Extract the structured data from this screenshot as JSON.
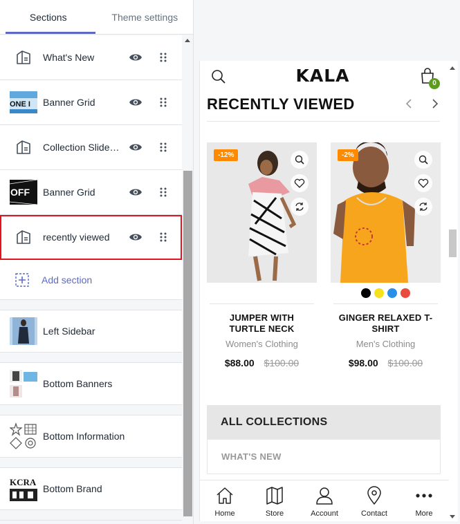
{
  "tabs": [
    {
      "label": "Sections",
      "active": true
    },
    {
      "label": "Theme settings",
      "active": false
    }
  ],
  "sections": [
    {
      "label": "What's New",
      "icon": "section-layout-icon"
    },
    {
      "label": "Banner Grid",
      "icon": "banner-thumbnail-one"
    },
    {
      "label": "Collection Slider…",
      "icon": "section-layout-icon"
    },
    {
      "label": "Banner Grid",
      "icon": "banner-thumbnail-off"
    },
    {
      "label": "recently viewed",
      "icon": "section-layout-icon",
      "selected": true
    }
  ],
  "add_section_label": "Add section",
  "static_sections": [
    {
      "label": "Left Sidebar"
    },
    {
      "label": "Bottom Banners"
    },
    {
      "label": "Bottom Information"
    },
    {
      "label": "Bottom Brand"
    }
  ],
  "thumb_text": {
    "one": "ONE I",
    "off": "OFF",
    "brand": "KCRA"
  },
  "preview": {
    "logo": "KALA",
    "cart_count": "0",
    "recently_viewed_title": "RECENTLY VIEWED",
    "products": [
      {
        "badge": "-12%",
        "name": "JUMPER WITH TURTLE NECK",
        "category": "Women's Clothing",
        "price": "$88.00",
        "old_price": "$100.00"
      },
      {
        "badge": "-2%",
        "name": "GINGER RELAXED T-SHIRT",
        "category": "Men's Clothing",
        "price": "$98.00",
        "old_price": "$100.00",
        "swatches": [
          "#000000",
          "#f5e11c",
          "#2a8fe6",
          "#e84c3d"
        ]
      }
    ],
    "collections_title": "ALL COLLECTIONS",
    "collection_items": [
      "WHAT'S NEW"
    ],
    "bottom_nav": [
      {
        "label": "Home",
        "icon": "home-icon"
      },
      {
        "label": "Store",
        "icon": "map-icon"
      },
      {
        "label": "Account",
        "icon": "user-icon"
      },
      {
        "label": "Contact",
        "icon": "location-pin-icon"
      },
      {
        "label": "More",
        "icon": "more-dots-icon"
      }
    ]
  },
  "colors": {
    "accent": "#5c6ac4",
    "selection": "#e0141e",
    "sale_badge": "#ff8a00",
    "cart_badge": "#5c9e1b"
  }
}
